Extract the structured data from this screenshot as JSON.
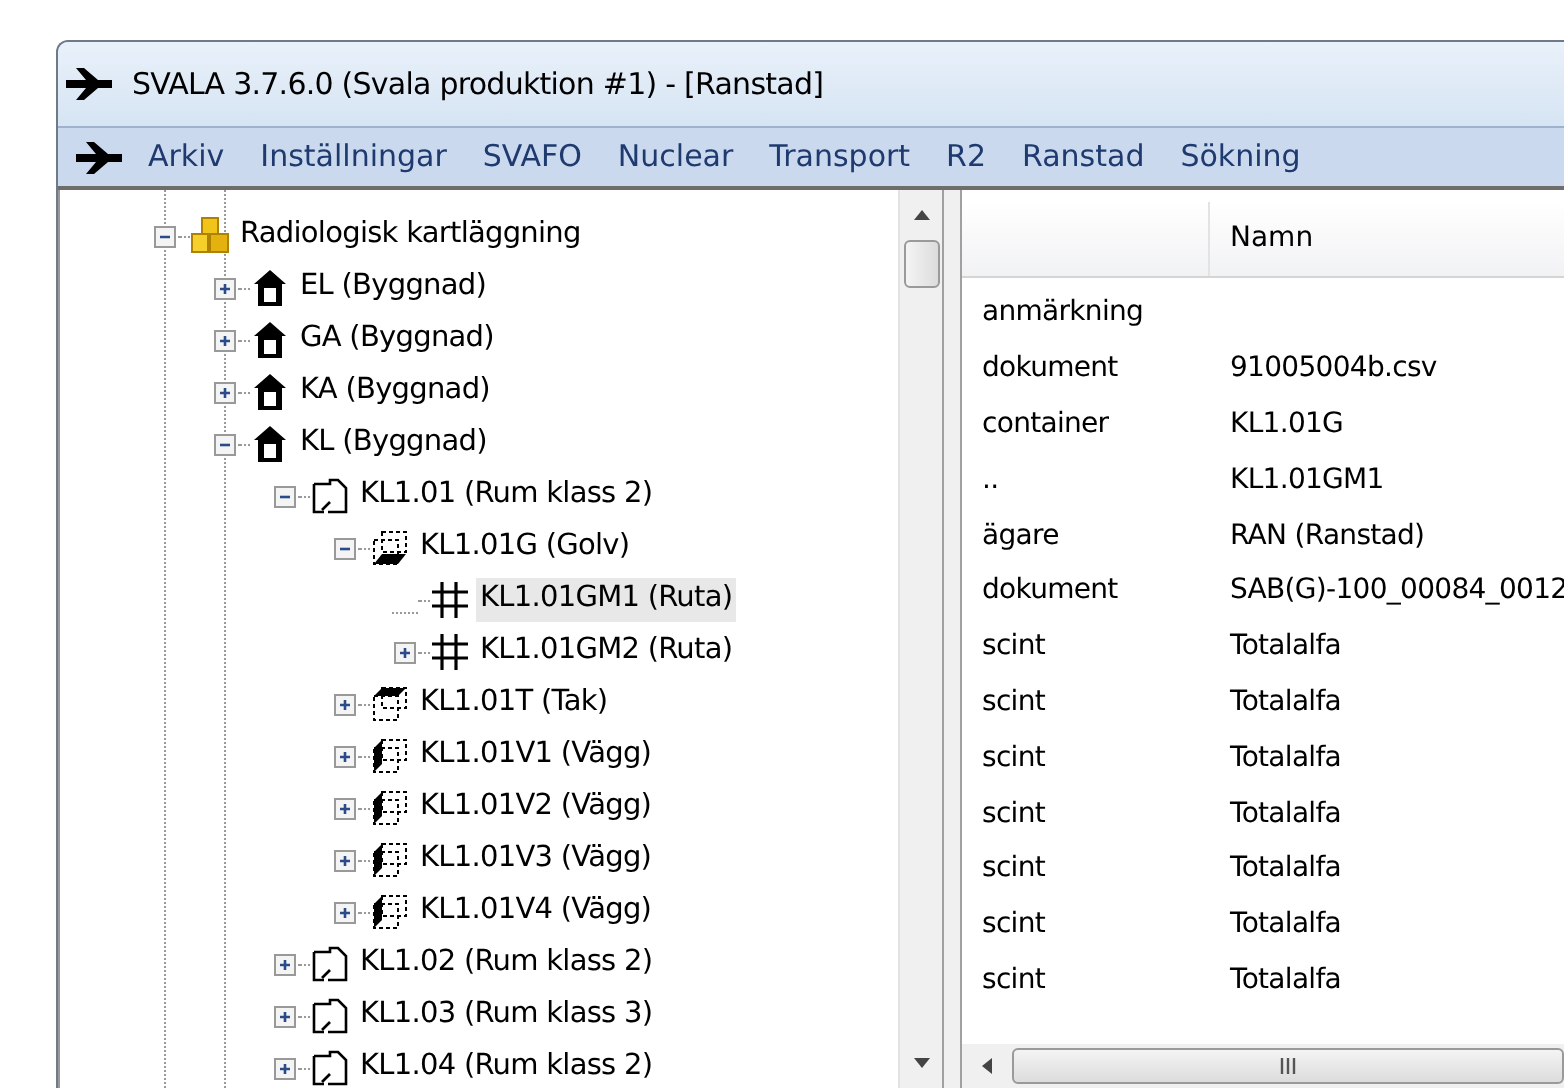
{
  "window": {
    "title": "SVALA 3.7.6.0 (Svala produktion #1) - [Ranstad]"
  },
  "menu": [
    "Arkiv",
    "Inställningar",
    "SVAFO",
    "Nuclear",
    "Transport",
    "R2",
    "Ranstad",
    "Sökning"
  ],
  "tree": [
    {
      "label": "Radiologisk kartläggning",
      "kind": "folder",
      "expandable": true,
      "expanded": true,
      "selected": false,
      "children": [
        {
          "label": "EL (Byggnad)",
          "kind": "building",
          "expandable": true,
          "expanded": false,
          "selected": false
        },
        {
          "label": "GA (Byggnad)",
          "kind": "building",
          "expandable": true,
          "expanded": false,
          "selected": false
        },
        {
          "label": "KA (Byggnad)",
          "kind": "building",
          "expandable": true,
          "expanded": false,
          "selected": false
        },
        {
          "label": "KL (Byggnad)",
          "kind": "building",
          "expandable": true,
          "expanded": true,
          "selected": false,
          "children": [
            {
              "label": "KL1.01 (Rum klass 2)",
              "kind": "room",
              "expandable": true,
              "expanded": true,
              "selected": false,
              "children": [
                {
                  "label": "KL1.01G (Golv)",
                  "kind": "floor",
                  "expandable": true,
                  "expanded": true,
                  "selected": false,
                  "children": [
                    {
                      "label": "KL1.01GM1 (Ruta)",
                      "kind": "grid",
                      "expandable": false,
                      "selected": true
                    },
                    {
                      "label": "KL1.01GM2 (Ruta)",
                      "kind": "grid",
                      "expandable": true,
                      "expanded": false,
                      "selected": false
                    }
                  ]
                },
                {
                  "label": "KL1.01T (Tak)",
                  "kind": "ceiling",
                  "expandable": true,
                  "expanded": false,
                  "selected": false
                },
                {
                  "label": "KL1.01V1 (Vägg)",
                  "kind": "wall",
                  "expandable": true,
                  "expanded": false,
                  "selected": false
                },
                {
                  "label": "KL1.01V2 (Vägg)",
                  "kind": "wall",
                  "expandable": true,
                  "expanded": false,
                  "selected": false
                },
                {
                  "label": "KL1.01V3 (Vägg)",
                  "kind": "wall",
                  "expandable": true,
                  "expanded": false,
                  "selected": false
                },
                {
                  "label": "KL1.01V4 (Vägg)",
                  "kind": "wall",
                  "expandable": true,
                  "expanded": false,
                  "selected": false
                }
              ]
            },
            {
              "label": "KL1.02 (Rum klass 2)",
              "kind": "room",
              "expandable": true,
              "expanded": false,
              "selected": false
            },
            {
              "label": "KL1.03 (Rum klass 3)",
              "kind": "room",
              "expandable": true,
              "expanded": false,
              "selected": false
            },
            {
              "label": "KL1.04 (Rum klass 2)",
              "kind": "room",
              "expandable": true,
              "expanded": false,
              "selected": false
            }
          ]
        }
      ]
    }
  ],
  "table": {
    "columns": [
      "Namn"
    ],
    "rows": [
      {
        "key": "anmärkning"
      },
      {
        "key": "dokument",
        "value": "91005004b.csv"
      },
      {
        "key": "container",
        "value": "KL1.01G"
      },
      {
        "key": "..",
        "value": "KL1.01GM1"
      },
      {
        "key": "ägare",
        "value": "RAN (Ranstad)"
      },
      {
        "key": "dokument",
        "value": "SAB(G)-100_00084_0012"
      },
      {
        "key": "scint",
        "value": "Totalalfa"
      },
      {
        "key": "scint",
        "value": "Totalalfa"
      },
      {
        "key": "scint",
        "value": "Totalalfa"
      },
      {
        "key": "scint",
        "value": "Totalalfa"
      },
      {
        "key": "scint",
        "value": "Totalalfa"
      },
      {
        "key": "scint",
        "value": "Totalalfa"
      },
      {
        "key": "scint",
        "value": "Totalalfa"
      }
    ]
  }
}
